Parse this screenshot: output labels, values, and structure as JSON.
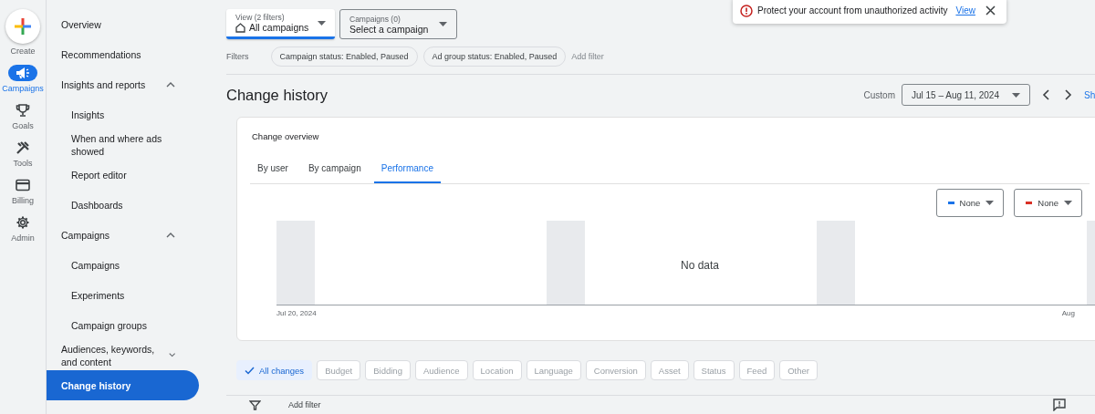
{
  "rail": [
    {
      "label": "Create",
      "kind": "create",
      "selected": false
    },
    {
      "label": "Campaigns",
      "kind": "campaigns",
      "selected": true
    },
    {
      "label": "Goals",
      "kind": "goals",
      "selected": false
    },
    {
      "label": "Tools",
      "kind": "tools",
      "selected": false
    },
    {
      "label": "Billing",
      "kind": "billing",
      "selected": false
    },
    {
      "label": "Admin",
      "kind": "admin",
      "selected": false
    }
  ],
  "nav": [
    {
      "label": "Overview",
      "selected": false
    },
    {
      "label": "Recommendations",
      "selected": false
    },
    {
      "label": "Insights and reports",
      "selected": false,
      "expanded": true,
      "children": [
        {
          "label": "Insights",
          "selected": false
        },
        {
          "label": "When and where ads showed",
          "selected": false
        },
        {
          "label": "Report editor",
          "selected": false
        },
        {
          "label": "Dashboards",
          "selected": false
        }
      ]
    },
    {
      "label": "Campaigns",
      "selected": false,
      "expanded": true,
      "children": [
        {
          "label": "Campaigns",
          "selected": false
        },
        {
          "label": "Experiments",
          "selected": false
        },
        {
          "label": "Campaign groups",
          "selected": false
        }
      ]
    },
    {
      "label": "Audiences, keywords, and content",
      "selected": false,
      "expanded": false
    },
    {
      "label": "Change history",
      "selected": true
    }
  ],
  "view_select": {
    "label": "View (2 filters)",
    "value": "All campaigns"
  },
  "campaign_select": {
    "label": "Campaigns (0)",
    "value": "Select a campaign"
  },
  "notification": {
    "text": "Protect your account from unauthorized activity",
    "link": "View"
  },
  "filters": {
    "label": "Filters",
    "chips": [
      "Campaign status: Enabled, Paused",
      "Ad group status: Enabled, Paused"
    ],
    "add": "Add filter"
  },
  "page_title": "Change history",
  "date_range": {
    "label": "Custom",
    "value": "Jul 15 – Aug 11, 2024",
    "show_link": "Sh"
  },
  "overview": {
    "title": "Change overview",
    "tabs": [
      {
        "label": "By user",
        "selected": false
      },
      {
        "label": "By campaign",
        "selected": false
      },
      {
        "label": "Performance",
        "selected": true
      }
    ],
    "metrics": [
      {
        "label": "None",
        "color": "#1a73e8"
      },
      {
        "label": "None",
        "color": "#d93025"
      }
    ],
    "empty_text": "No data",
    "x_labels": [
      "Jul 20, 2024",
      "Aug"
    ]
  },
  "change_types": [
    {
      "label": "All changes",
      "selected": true
    },
    {
      "label": "Budget",
      "selected": false
    },
    {
      "label": "Bidding",
      "selected": false
    },
    {
      "label": "Audience",
      "selected": false
    },
    {
      "label": "Location",
      "selected": false
    },
    {
      "label": "Language",
      "selected": false
    },
    {
      "label": "Conversion",
      "selected": false
    },
    {
      "label": "Asset",
      "selected": false
    },
    {
      "label": "Status",
      "selected": false
    },
    {
      "label": "Feed",
      "selected": false
    },
    {
      "label": "Other",
      "selected": false
    }
  ],
  "table_toolbar": {
    "add_filter": "Add filter"
  }
}
